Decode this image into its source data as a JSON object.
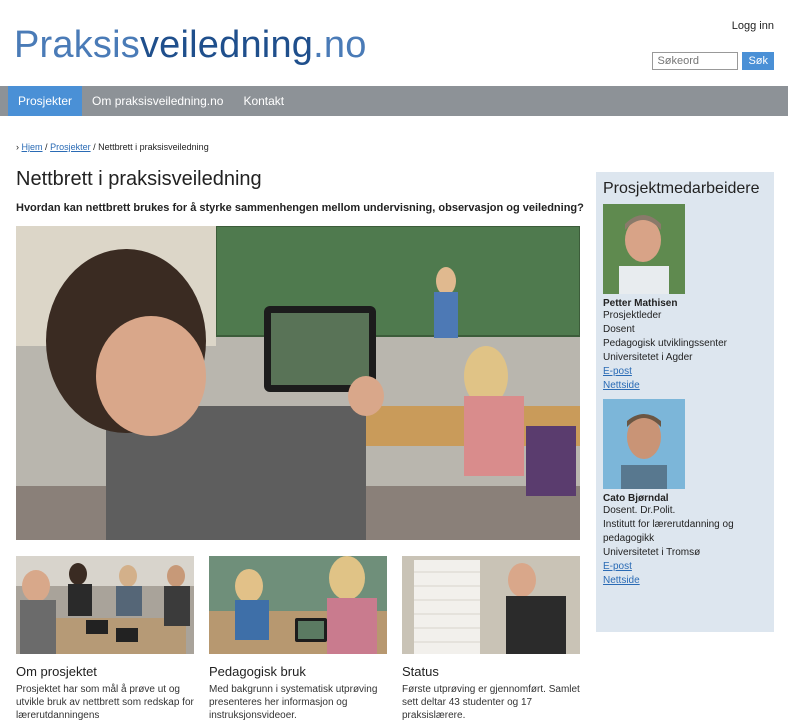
{
  "header": {
    "logo_part1": "Praksis",
    "logo_part2": "veiledning",
    "logo_part3": ".no",
    "login": "Logg inn",
    "search_placeholder": "Søkeord",
    "search_button": "Søk"
  },
  "nav": {
    "items": [
      "Prosjekter",
      "Om praksisveiledning.no",
      "Kontakt"
    ],
    "active_index": 0
  },
  "breadcrumb": {
    "home": "Hjem",
    "sep": "/",
    "projects": "Prosjekter",
    "current": "Nettbrett i praksisveiledning"
  },
  "main": {
    "title": "Nettbrett i praksisveiledning",
    "subtitle": "Hvordan kan nettbrett brukes for å styrke sammenhengen mellom undervisning, observasjon og veiledning?"
  },
  "cards": [
    {
      "title": "Om prosjektet",
      "text": "Prosjektet har som mål å prøve ut og utvikle bruk av nettbrett som redskap for lærerutdanningens"
    },
    {
      "title": "Pedagogisk bruk",
      "text": "Med bakgrunn i systematisk utprøving presenteres her informasjon og instruksjonsvideoer."
    },
    {
      "title": "Status",
      "text": "Første utprøving er gjennomført. Samlet sett deltar 43 studenter og 17 praksislærere."
    }
  ],
  "sidebar": {
    "title": "Prosjektmedarbeidere",
    "people": [
      {
        "name": "Petter Mathisen",
        "lines": [
          "Prosjektleder",
          "Dosent",
          "Pedagogisk utviklingssenter",
          "Universitetet i Agder"
        ],
        "email": "E-post",
        "web": "Nettside"
      },
      {
        "name": "Cato Bjørndal",
        "lines": [
          "Dosent. Dr.Polit.",
          "Institutt for lærerutdanning og pedagogikk",
          "Universitetet i Tromsø"
        ],
        "email": "E-post",
        "web": "Nettside"
      }
    ]
  },
  "colors": {
    "accent": "#4a90d6",
    "nav_bg": "#8d9297",
    "sidebar_bg": "#dde6ef",
    "logo_dark": "#1f4f8c",
    "logo_light": "#4a7bb7"
  }
}
